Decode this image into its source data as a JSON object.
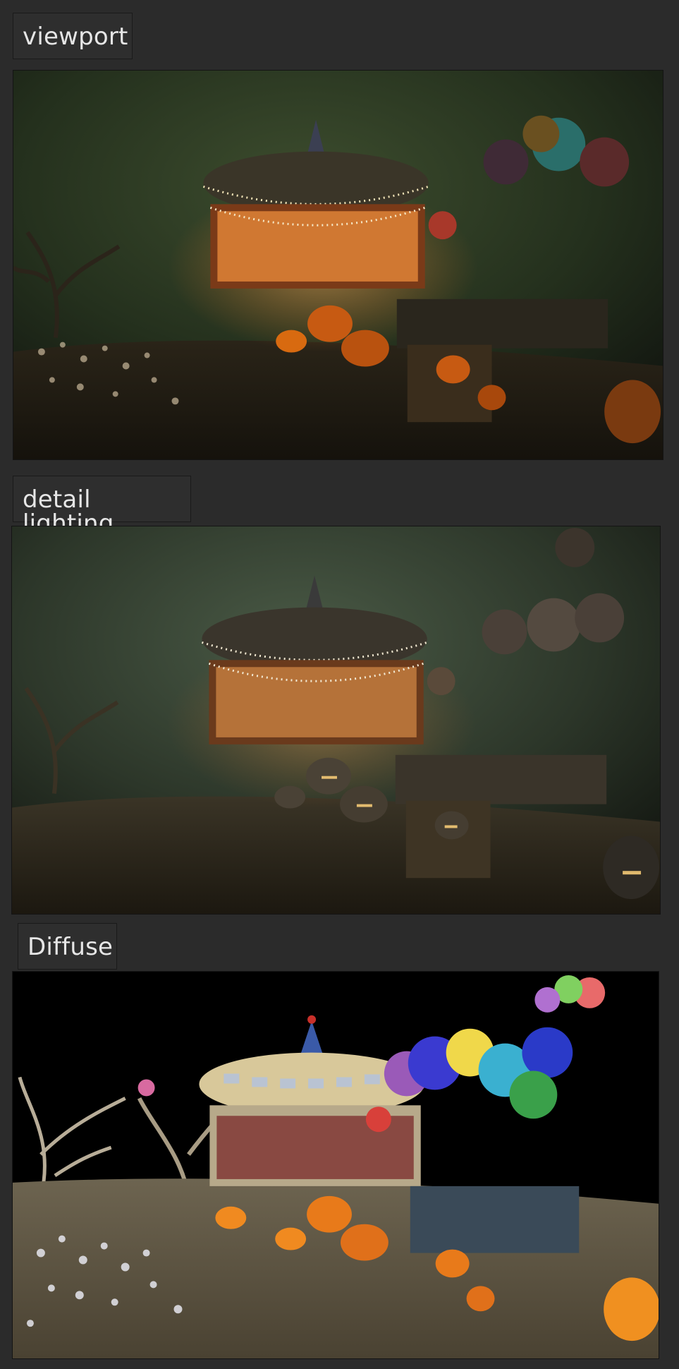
{
  "panels": [
    {
      "label": "viewport",
      "render_mode": "viewport"
    },
    {
      "label": "detail lighting",
      "render_mode": "detail-lighting"
    },
    {
      "label": "Diffuse",
      "render_mode": "diffuse"
    }
  ],
  "colors": {
    "page_background": "#2b2b2b",
    "label_background": "#2e2e2e",
    "label_text": "#e6e6e6",
    "viewport_sky": "#2f3f27",
    "detail_sky": "#3a4a36",
    "diffuse_sky": "#000000",
    "pumpkin": "#d86a10",
    "carousel_glow": "#ffb060"
  }
}
